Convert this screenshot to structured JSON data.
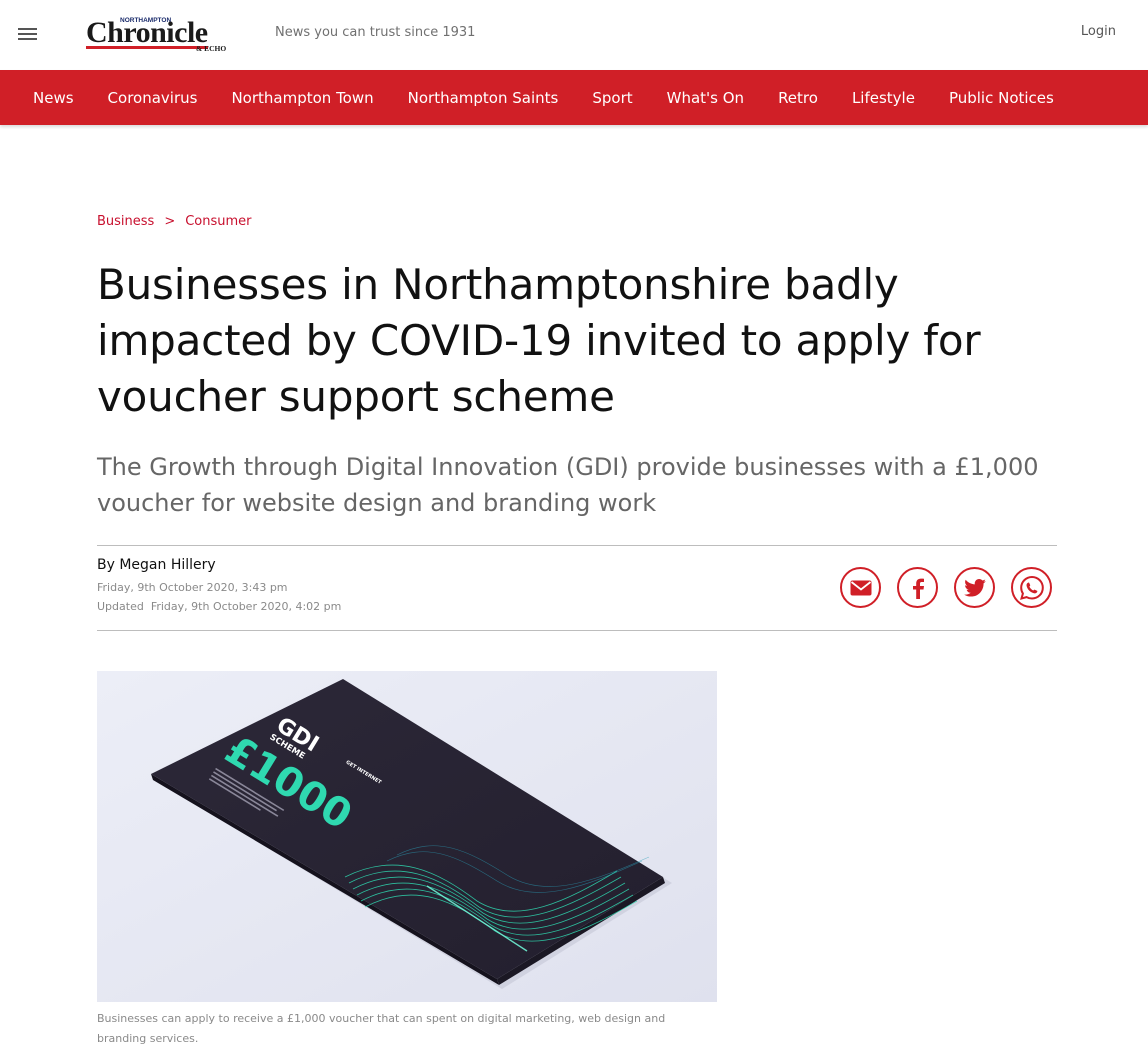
{
  "header": {
    "logo": {
      "small_text": "NORTHAMPTON",
      "name": "Chronicle",
      "suffix": "& ECHO"
    },
    "tagline": "News you can trust since 1931",
    "login_label": "Login",
    "menu_icon": "hamburger-menu-icon"
  },
  "nav": {
    "items": [
      {
        "label": "News"
      },
      {
        "label": "Coronavirus"
      },
      {
        "label": "Northampton Town"
      },
      {
        "label": "Northampton Saints"
      },
      {
        "label": "Sport"
      },
      {
        "label": "What's On"
      },
      {
        "label": "Retro"
      },
      {
        "label": "Lifestyle"
      },
      {
        "label": "Public Notices"
      }
    ],
    "color": "#d01f27"
  },
  "article": {
    "breadcrumb": [
      {
        "label": "Business"
      },
      {
        "label": "Consumer"
      }
    ],
    "breadcrumb_separator": ">",
    "headline": "Businesses in Northamptonshire badly impacted by COVID-19 invited to apply for voucher support scheme",
    "standfirst": "The Growth through Digital Innovation (GDI) provide businesses with a £1,000 voucher for website design and branding work",
    "byline_prefix": "By",
    "author": "Megan Hillery",
    "published": "Friday, 9th October 2020, 3:43 pm",
    "updated_label": "Updated",
    "updated": "Friday, 9th October 2020, 4:02 pm",
    "share_buttons": [
      {
        "icon": "email-icon"
      },
      {
        "icon": "facebook-icon"
      },
      {
        "icon": "twitter-icon"
      },
      {
        "icon": "whatsapp-icon"
      }
    ],
    "hero_image": {
      "voucher_title": "GDI",
      "voucher_subtitle": "SCHEME",
      "voucher_amount": "£1000",
      "voucher_brand": "GET INTERNET"
    },
    "caption": "Businesses can apply to receive a £1,000 voucher that can spent on digital marketing, web design and branding services."
  },
  "colors": {
    "accent": "#d01f27",
    "voucher_dark": "#2a2635",
    "voucher_teal": "#2fd9b0",
    "image_bg": "#e6e7f2"
  }
}
